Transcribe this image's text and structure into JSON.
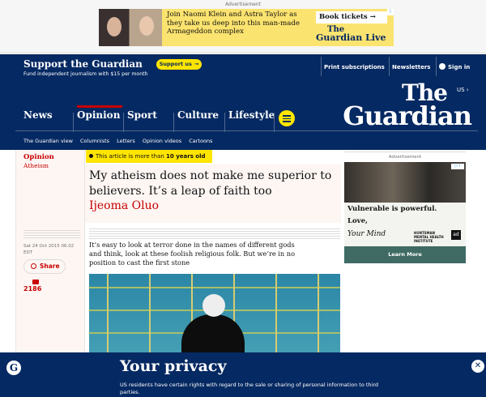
{
  "top_ad": {
    "label": "Advertisement",
    "text": "Join Naomi Klein and Astra Taylor as they take us deep into this man-made Armageddon complex",
    "button": "Book tickets",
    "arrow": "→",
    "brand_line1": "The",
    "brand_line2": "Guardian Live"
  },
  "support_bar": {
    "title": "Support the Guardian",
    "subtitle": "Fund independent journalism with $15 per month",
    "button": "Support us",
    "button_arrow": "→",
    "links": [
      "Print subscriptions",
      "Newsletters",
      "Sign in"
    ]
  },
  "header": {
    "edition": "US",
    "edition_chevron": "›",
    "logo_line1": "The",
    "logo_line2": "Guardian",
    "nav": [
      "News",
      "Opinion",
      "Sport",
      "Culture",
      "Lifestyle"
    ],
    "subnav": [
      "The Guardian view",
      "Columnists",
      "Letters",
      "Opinion videos",
      "Cartoons"
    ]
  },
  "article": {
    "section": "Opinion",
    "series": "Atheism",
    "age_prefix": "This article is more than",
    "age_bold": "10 years old",
    "headline": "My atheism does not make me superior to believers. It’s a leap of faith too",
    "byline": "Ijeoma Oluo",
    "date": "Sat 24 Oct 2015 06.02 EDT",
    "share_label": "Share",
    "comment_count": "2186",
    "standfirst": "It’s easy to look at terror done in the names of different gods and think, look at these foolish religious folk. But we’re in no position to cast the first stone"
  },
  "right_ad": {
    "label": "Advertisement",
    "line1": "Vulnerable is powerful.",
    "line2": "Love,",
    "line3": "Your Mind",
    "sponsor": "HUNTSMAN MENTAL HEALTH INSTITUTE",
    "cta": "Learn More",
    "ad_badge": "▷ i"
  },
  "privacy": {
    "title": "Your privacy",
    "text": "US residents have certain rights with regard to the sale or sharing of personal information to third parties.",
    "close": "✕"
  },
  "colors": {
    "brand_blue": "#052962",
    "opinion_red": "#c70000",
    "highlight_yellow": "#ffe500",
    "opinion_bg": "#fdf6f3"
  }
}
